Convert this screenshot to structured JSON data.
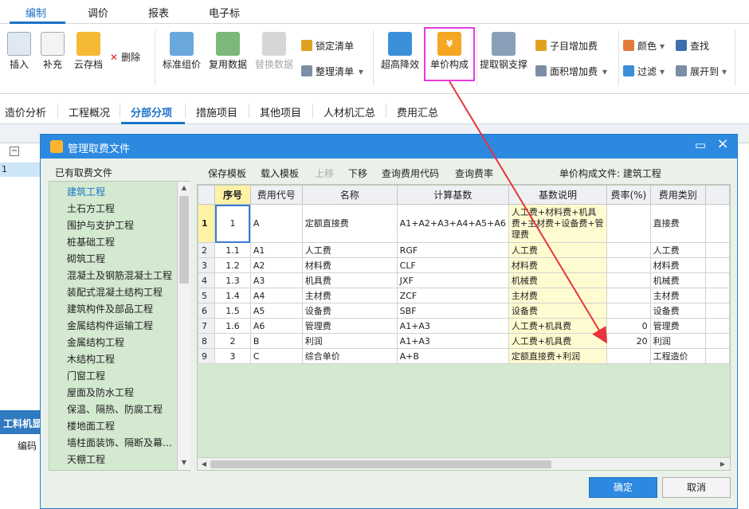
{
  "menu": {
    "tabs": [
      "编制",
      "调价",
      "报表",
      "电子标"
    ]
  },
  "ribbon": {
    "buttons": [
      "插入",
      "补充",
      "云存档",
      "删除",
      "标准组价",
      "复用数据",
      "替换数据",
      "锁定清单",
      "整理清单",
      "超高降效",
      "单价构成",
      "提取钢支撑",
      "子目增加费",
      "面积增加费",
      "颜色",
      "查找",
      "过滤",
      "展开到"
    ]
  },
  "tabs": [
    "造价分析",
    "工程概况",
    "分部分项",
    "措施项目",
    "其他项目",
    "人材机汇总",
    "费用汇总"
  ],
  "background": {
    "bottom_panel_label": "工料机显",
    "bottom_col": "编码",
    "row_num": "1"
  },
  "dialog": {
    "title": "管理取费文件",
    "left_label": "已有取费文件",
    "files": [
      "建筑工程",
      "土石方工程",
      "围护与支护工程",
      "桩基础工程",
      "砌筑工程",
      "混凝土及钢筋混凝土工程",
      "装配式混凝土结构工程",
      "建筑构件及部品工程",
      "金属结构件运输工程",
      "金属结构工程",
      "木结构工程",
      "门窗工程",
      "屋面及防水工程",
      "保温、隔热、防腐工程",
      "楼地面工程",
      "墙柱面装饰、隔断及幕…",
      "天棚工程"
    ],
    "toolbar": [
      "保存模板",
      "载入模板",
      "上移",
      "下移",
      "查询费用代码",
      "查询费率"
    ],
    "file_label": "单价构成文件: 建筑工程",
    "columns": [
      "",
      "序号",
      "费用代号",
      "名称",
      "计算基数",
      "基数说明",
      "费率(%)",
      "费用类别"
    ],
    "rows": [
      {
        "rn": "1",
        "seq": "1",
        "code": "A",
        "name": "定额直接费",
        "base": "A1+A2+A3+A4+A5+A6",
        "desc": "人工费+材料费+机具费+主材费+设备费+管理费",
        "rate": "",
        "type": "直接费"
      },
      {
        "rn": "2",
        "seq": "1.1",
        "code": "A1",
        "name": "人工费",
        "base": "RGF",
        "desc": "人工费",
        "rate": "",
        "type": "人工费"
      },
      {
        "rn": "3",
        "seq": "1.2",
        "code": "A2",
        "name": "材料费",
        "base": "CLF",
        "desc": "材料费",
        "rate": "",
        "type": "材料费"
      },
      {
        "rn": "4",
        "seq": "1.3",
        "code": "A3",
        "name": "机具费",
        "base": "JXF",
        "desc": "机械费",
        "rate": "",
        "type": "机械费"
      },
      {
        "rn": "5",
        "seq": "1.4",
        "code": "A4",
        "name": "主材费",
        "base": "ZCF",
        "desc": "主材费",
        "rate": "",
        "type": "主材费"
      },
      {
        "rn": "6",
        "seq": "1.5",
        "code": "A5",
        "name": "设备费",
        "base": "SBF",
        "desc": "设备费",
        "rate": "",
        "type": "设备费"
      },
      {
        "rn": "7",
        "seq": "1.6",
        "code": "A6",
        "name": "管理费",
        "base": "A1+A3",
        "desc": "人工费+机具费",
        "rate": "0",
        "type": "管理费"
      },
      {
        "rn": "8",
        "seq": "2",
        "code": "B",
        "name": "利润",
        "base": "A1+A3",
        "desc": "人工费+机具费",
        "rate": "20",
        "type": "利润"
      },
      {
        "rn": "9",
        "seq": "3",
        "code": "C",
        "name": "综合单价",
        "base": "A+B",
        "desc": "定额直接费+利润",
        "rate": "",
        "type": "工程造价"
      }
    ],
    "ok": "确定",
    "cancel": "取消"
  },
  "colors": {
    "accent": "#2d89e0",
    "highlight_box": "#e83be0",
    "arrow": "#e8343a",
    "panel_green": "#d3e9d0",
    "basis_yellow": "#fffbd0"
  }
}
